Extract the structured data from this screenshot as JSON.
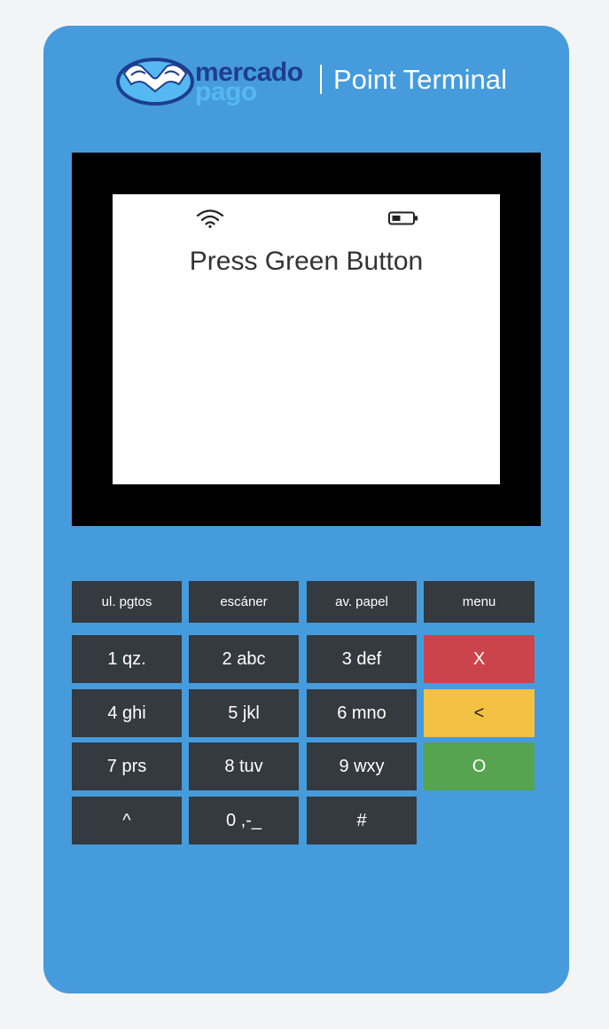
{
  "header": {
    "logo_text_top": "mercado",
    "logo_text_bottom": "pago",
    "title": "Point Terminal"
  },
  "screen": {
    "status_icons": [
      "wifi-icon",
      "battery-icon"
    ],
    "message": "Press Green Button"
  },
  "keypad": {
    "function_keys": [
      "ul. pgtos",
      "escáner",
      "av. papel",
      "menu"
    ],
    "rows": [
      [
        "1 qz.",
        "2 abc",
        "3 def"
      ],
      [
        "4 ghi",
        "5 jkl",
        "6 mno"
      ],
      [
        "7 prs",
        "8 tuv",
        "9 wxy"
      ],
      [
        "^",
        "0 ,-_",
        "#"
      ]
    ],
    "cancel_label": "X",
    "backspace_label": "<",
    "confirm_label": "O"
  },
  "colors": {
    "device_body": "#469bdc",
    "key": "#343a40",
    "cancel": "#cc444b",
    "backspace": "#f3c144",
    "confirm": "#56a350"
  }
}
